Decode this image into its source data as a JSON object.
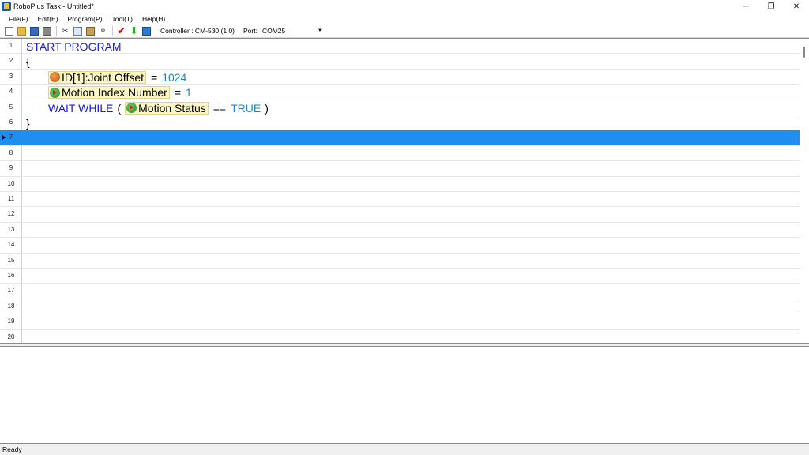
{
  "window": {
    "title": "RoboPlus Task - Untitled*",
    "controls": {
      "minimize": "─",
      "restore": "❐",
      "close": "✕"
    }
  },
  "menu": [
    "File(F)",
    "Edit(E)",
    "Program(P)",
    "Tool(T)",
    "Help(H)"
  ],
  "toolbar": {
    "controller_label": "Controller : CM-530 (1.0)",
    "port_label": "Port:",
    "port_value": "COM25",
    "cut_glyph": "✂",
    "link_glyph": "⚭",
    "check_glyph": "✔",
    "download_glyph": "⬇"
  },
  "editor": {
    "line_numbers": [
      "1",
      "2",
      "3",
      "4",
      "5",
      "6",
      "7",
      "8",
      "9",
      "10",
      "11",
      "12",
      "13",
      "14",
      "15",
      "16",
      "17",
      "18",
      "19",
      "20"
    ],
    "selected_line": 7,
    "lines": {
      "l1": {
        "keyword": "START PROGRAM"
      },
      "l2": {
        "brace": "{"
      },
      "l3": {
        "param": "ID[1]:Joint Offset",
        "op": "=",
        "value": "1024"
      },
      "l4": {
        "param": "Motion Index Number",
        "op": "=",
        "value": "1"
      },
      "l5": {
        "keyword": "WAIT WHILE",
        "open": "(",
        "param": "Motion Status",
        "op": "==",
        "value": "TRUE",
        "close": ")"
      },
      "l6": {
        "brace": "}"
      }
    }
  },
  "status": {
    "text": "Ready"
  }
}
